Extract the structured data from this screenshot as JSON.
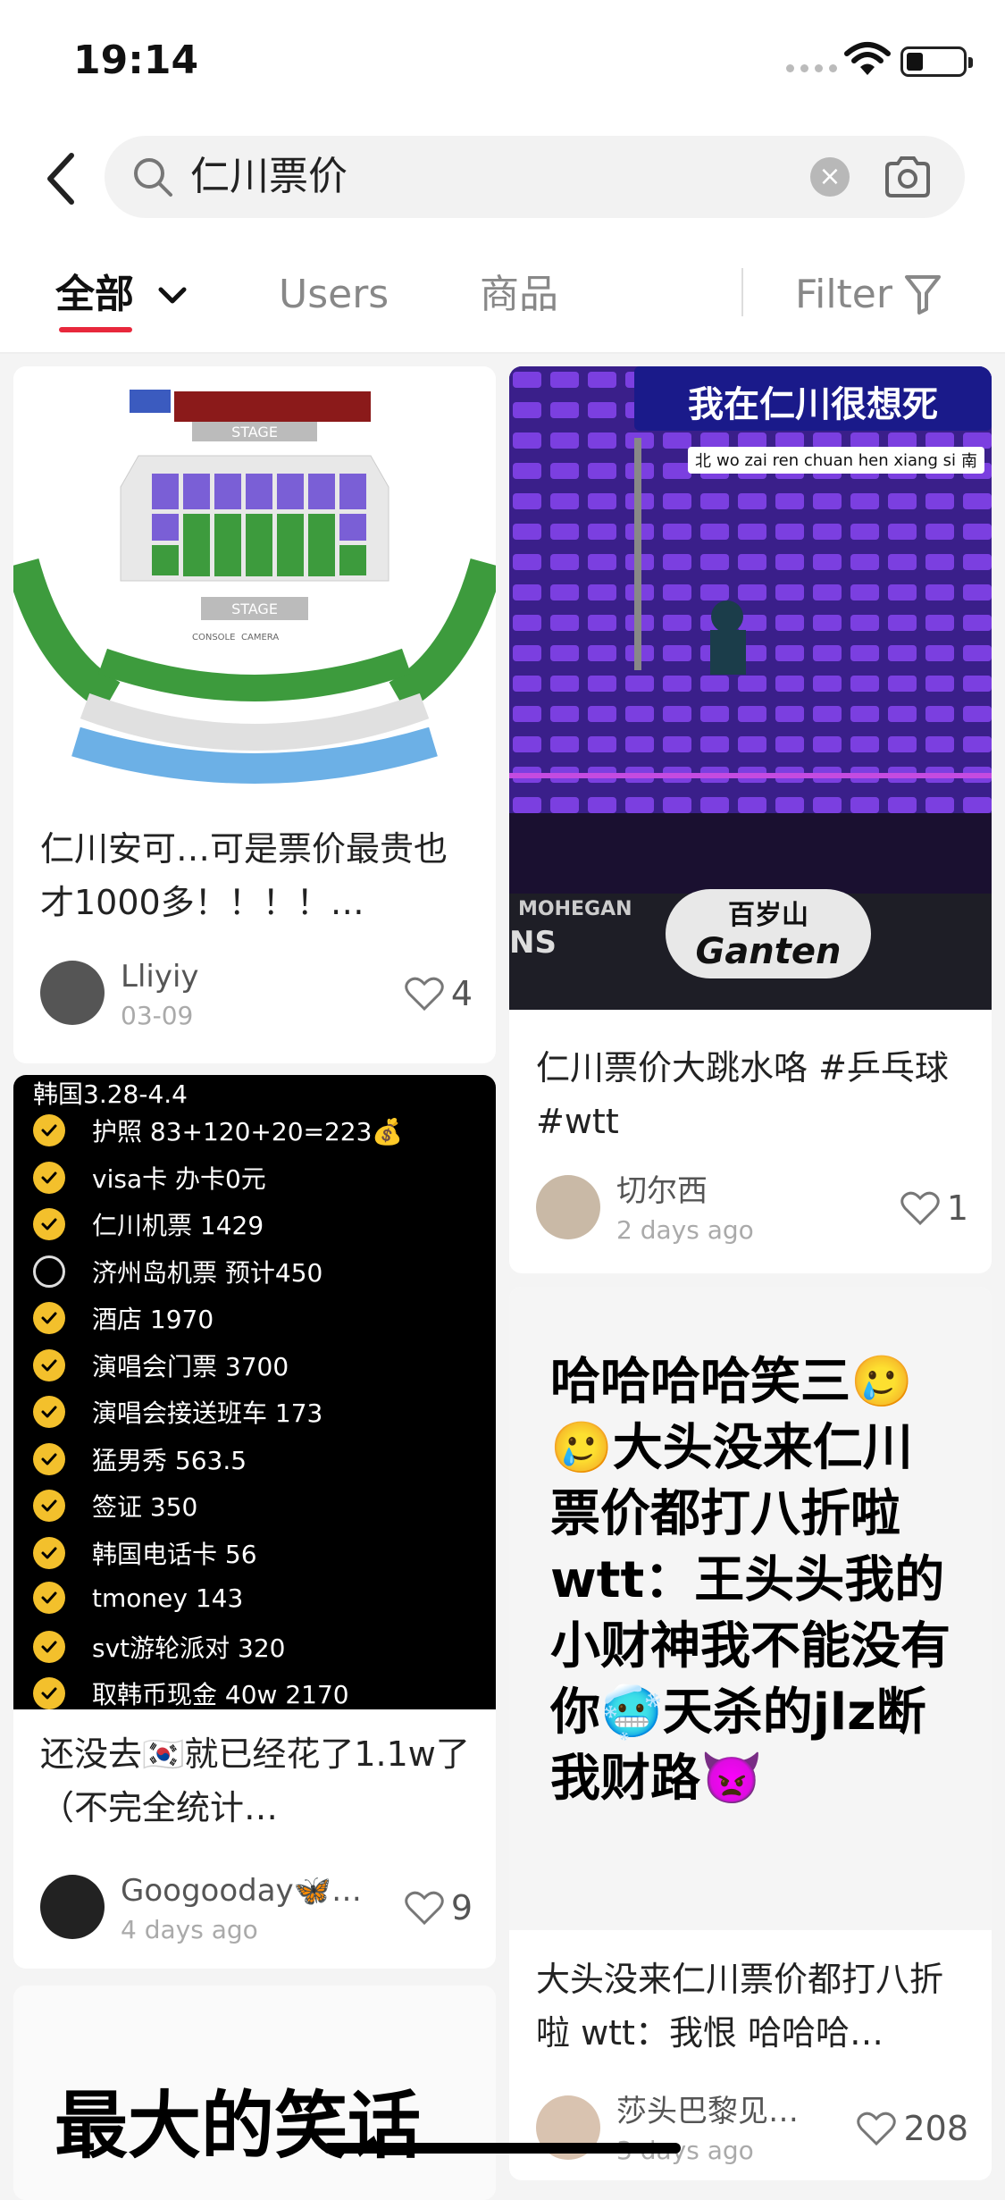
{
  "status": {
    "time": "19:14"
  },
  "search": {
    "query": "仁川票价"
  },
  "tabs": {
    "all": "全部",
    "users": "Users",
    "goods": "商品",
    "filter": "Filter"
  },
  "cards": {
    "c1": {
      "title": "仁川安可…可是票价最贵也才1000多！！！！…",
      "user": "Lliyiy",
      "date": "03-09",
      "likes": "4"
    },
    "c2": {
      "title": "仁川票价大跳水咯 #乒乓球 #wtt",
      "user": "切尔西",
      "date": "2 days ago",
      "likes": "1",
      "banner": "我在仁川很想死",
      "subtitle": "wo zai ren chuan hen xiang si",
      "sub_left": "北",
      "sub_right": "南",
      "sponsor": "百岁山",
      "sponsor_en": "Ganten",
      "mohegan": "MOHEGAN",
      "ns": "NS"
    },
    "c3": {
      "title": "还没去🇰🇷就已经花了1.1w了（不完全统计…",
      "user": "Googooday🦋…",
      "date": "4 days ago",
      "likes": "9",
      "header": "韩国3.28-4.4",
      "items": [
        {
          "t": "护照 83+120+20=223💰",
          "done": true
        },
        {
          "t": "visa卡 办卡0元",
          "done": true
        },
        {
          "t": "仁川机票 1429",
          "done": true
        },
        {
          "t": "济州岛机票 预计450",
          "done": false
        },
        {
          "t": "酒店 1970",
          "done": true
        },
        {
          "t": "演唱会门票 3700",
          "done": true
        },
        {
          "t": "演唱会接送班车 173",
          "done": true
        },
        {
          "t": "猛男秀 563.5",
          "done": true
        },
        {
          "t": "签证 350",
          "done": true
        },
        {
          "t": "韩国电话卡 56",
          "done": true
        },
        {
          "t": "tmoney 143",
          "done": true
        },
        {
          "t": "svt游轮派对 320",
          "done": true
        },
        {
          "t": "取韩币现金 40w 2170",
          "done": true
        }
      ]
    },
    "c4": {
      "meme": "哈哈哈哈笑三🥲🥲大头没来仁川票价都打八折啦wtt：王头头我的小财神我不能没有你🥶天杀的jlz断我财路👿",
      "title": "大头没来仁川票价都打八折啦 wtt：我恨 哈哈哈…",
      "user": "莎头巴黎见…",
      "date": "3 days ago",
      "likes": "208"
    },
    "c5": {
      "big": "最大的笑话"
    }
  },
  "seatmap": {
    "stage": "STAGE",
    "stage2": "STAGE",
    "console": "CONSOLE",
    "camera": "CAMERA"
  }
}
